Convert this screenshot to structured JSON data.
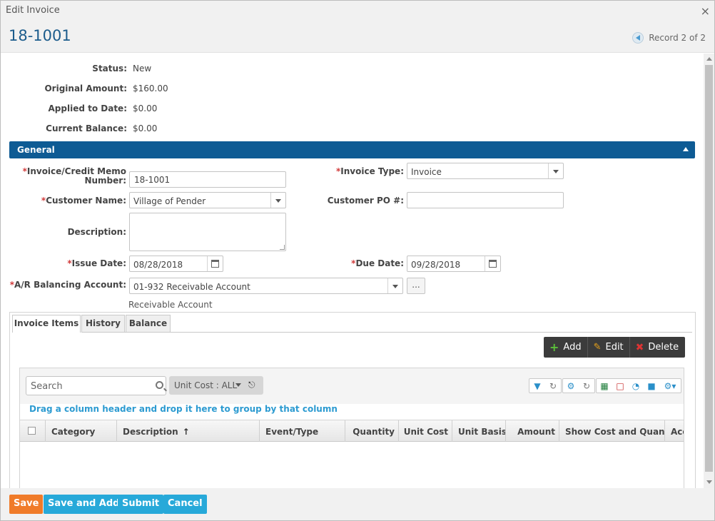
{
  "window": {
    "title": "Edit Invoice",
    "close": "×"
  },
  "header": {
    "record_id": "18-1001",
    "record_nav": "Record 2 of 2"
  },
  "summary": {
    "status_label": "Status:",
    "status_value": "New",
    "original_label": "Original Amount:",
    "original_value": "$160.00",
    "applied_label": "Applied to Date:",
    "applied_value": "$0.00",
    "balance_label": "Current Balance:",
    "balance_value": "$0.00"
  },
  "section": {
    "title": "General"
  },
  "form": {
    "invoice_number_label_1": "Invoice/Credit Memo",
    "invoice_number_label_2": "Number:",
    "invoice_number_value": "18-1001",
    "invoice_type_label": "Invoice Type:",
    "invoice_type_value": "Invoice",
    "customer_name_label": "Customer Name:",
    "customer_name_value": "Village of Pender",
    "customer_po_label": "Customer PO #:",
    "customer_po_value": "",
    "description_label": "Description:",
    "issue_date_label": "Issue Date:",
    "issue_date_value": "08/28/2018",
    "due_date_label": "Due Date:",
    "due_date_value": "09/28/2018",
    "ar_account_label": "A/R Balancing Account:",
    "ar_account_value": "01-932 Receivable Account",
    "ar_account_subtext": "Receivable Account",
    "ellipsis": "...",
    "required_marker": "*"
  },
  "tabs": [
    {
      "label": "Invoice Items"
    },
    {
      "label": "History"
    },
    {
      "label": "Balance"
    }
  ],
  "grid_actions": {
    "add": "Add",
    "edit": "Edit",
    "delete": "Delete"
  },
  "grid": {
    "search_placeholder": "Search",
    "filter_chip": "Unit Cost : ALL",
    "group_hint": "Drag a column header and drop it here to group by that column",
    "columns": [
      "Category",
      "Description",
      "Event/Type",
      "Quantity",
      "Unit Cost",
      "Unit Basis",
      "Amount",
      "Show Cost and Quant...",
      "Acc"
    ],
    "sort_arrow": "↑",
    "tool_icons": [
      "filter-icon",
      "refresh-icon",
      "wrench-icon",
      "reset-icon",
      "excel-icon",
      "pdf-icon",
      "chart-icon",
      "document-icon",
      "gear-icon"
    ]
  },
  "footer": {
    "save": "Save",
    "save_and_add": "Save and Add",
    "submit": "Submit",
    "cancel": "Cancel"
  },
  "colors": {
    "accent": "#0e5b94",
    "save": "#f07b29",
    "button": "#27a9d9",
    "link": "#2d9bd1",
    "required": "#d23b3b"
  }
}
